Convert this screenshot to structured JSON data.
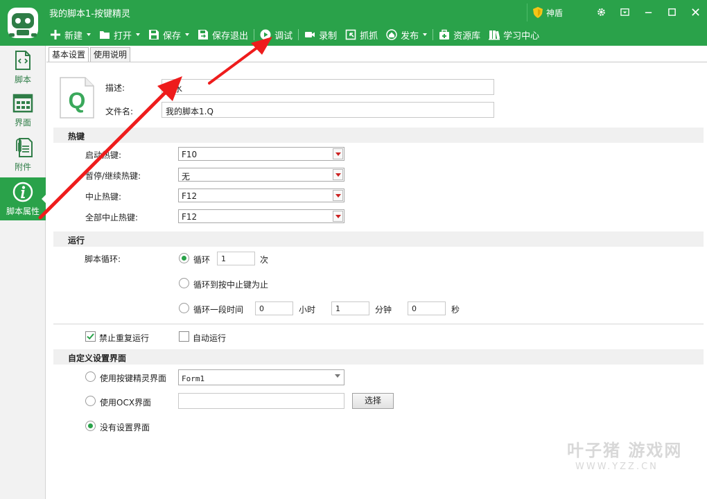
{
  "window": {
    "title": "我的脚本1-按键精灵",
    "shendun": "神盾"
  },
  "toolbar": {
    "new": "新建",
    "open": "打开",
    "save": "保存",
    "save_exit": "保存退出",
    "debug": "调试",
    "record": "录制",
    "grab": "抓抓",
    "publish": "发布",
    "resource": "资源库",
    "learn": "学习中心"
  },
  "sidebar": {
    "items": [
      {
        "label": "脚本",
        "icon": "code-file-icon"
      },
      {
        "label": "界面",
        "icon": "grid-icon"
      },
      {
        "label": "附件",
        "icon": "paperclip-icon"
      },
      {
        "label": "脚本属性",
        "icon": "info-icon"
      }
    ]
  },
  "tabs": [
    "基本设置",
    "使用说明"
  ],
  "basic": {
    "desc_label": "描述:",
    "desc_value": "传水",
    "filename_label": "文件名:",
    "filename_value": "我的脚本1.Q"
  },
  "hotkeys": {
    "section": "热键",
    "rows": [
      {
        "label": "启动热键:",
        "value": "F10"
      },
      {
        "label": "暂停/继续热键:",
        "value": "无"
      },
      {
        "label": "中止热键:",
        "value": "F12"
      },
      {
        "label": "全部中止热键:",
        "value": "F12"
      }
    ]
  },
  "run": {
    "section": "运行",
    "loop_label": "脚本循环:",
    "opt_loop": "循环",
    "loop_count": "1",
    "times_unit": "次",
    "opt_until_stop": "循环到按中止键为止",
    "opt_duration": "循环一段时间",
    "hours": "0",
    "hours_unit": "小时",
    "minutes": "1",
    "minutes_unit": "分钟",
    "seconds": "0",
    "seconds_unit": "秒",
    "no_repeat": "禁止重复运行",
    "auto_run": "自动运行"
  },
  "custom_ui": {
    "section": "自定义设置界面",
    "opt_form": "使用按键精灵界面",
    "form_value": "Form1",
    "opt_ocx": "使用OCX界面",
    "ocx_value": "",
    "choose": "选择",
    "opt_none": "没有设置界面"
  },
  "watermark": {
    "line1": "叶子猪 游戏网",
    "line2": "WWW.YZZ.CN"
  },
  "colors": {
    "brand_green": "#2aa24a",
    "annotation_red": "#ee1c1c"
  }
}
